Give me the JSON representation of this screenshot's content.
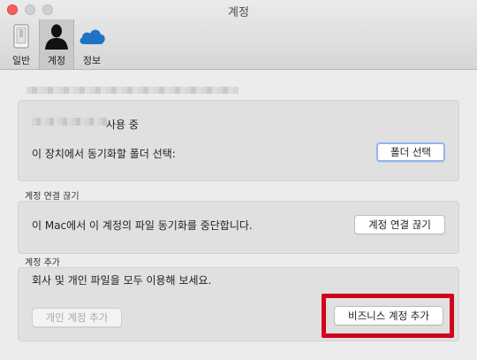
{
  "window": {
    "title": "계정"
  },
  "toolbar": {
    "tabs": [
      {
        "label": "일반",
        "icon": "switch-icon"
      },
      {
        "label": "계정",
        "icon": "person-icon"
      },
      {
        "label": "정보",
        "icon": "cloud-icon"
      }
    ],
    "selected_tab": "계정"
  },
  "account": {
    "usage_suffix": "사용 중",
    "sync_folder_text": "이 장치에서 동기화할 폴더 선택:",
    "choose_folder_button": "폴더 선택"
  },
  "unlink": {
    "section_title": "계정 연결 끊기",
    "description": "이 Mac에서 이 계정의 파일 동기화를 중단합니다.",
    "button": "계정 연결 끊기"
  },
  "add_account": {
    "section_title": "계정 추가",
    "description": "회사 및 개인 파일을 모두 이용해 보세요.",
    "personal_button": "개인 계정 추가",
    "business_button": "비즈니스 계정 추가"
  },
  "colors": {
    "highlight": "#d0021b",
    "close_button": "#fc605c",
    "cloud_blue": "#1e73c7",
    "focus_ring": "#8fb8ec"
  }
}
